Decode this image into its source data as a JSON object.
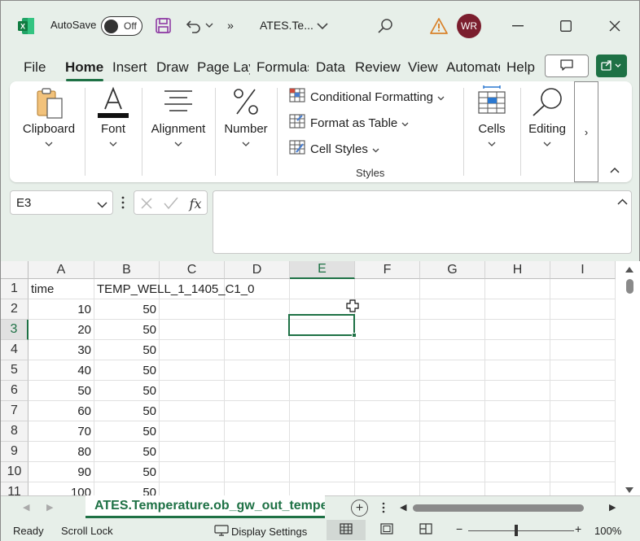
{
  "titlebar": {
    "autosave_label": "AutoSave",
    "toggle_text": "Off",
    "doc_title": "ATES.Te...",
    "avatar_initials": "WR",
    "more_glyph": "»"
  },
  "tabs": [
    "File",
    "Home",
    "Insert",
    "Draw",
    "Page Layout",
    "Formulas",
    "Data",
    "Review",
    "View",
    "Automate",
    "Help"
  ],
  "ribbon": {
    "clipboard": "Clipboard",
    "font": "Font",
    "alignment": "Alignment",
    "number": "Number",
    "conditional_formatting": "Conditional Formatting",
    "format_as_table": "Format as Table",
    "cell_styles": "Cell Styles",
    "styles_group": "Styles",
    "cells": "Cells",
    "editing": "Editing",
    "more_glyph": "›"
  },
  "formula_bar": {
    "name_box": "E3",
    "fx": "fx",
    "value": ""
  },
  "grid": {
    "columns": [
      "A",
      "B",
      "C",
      "D",
      "E",
      "F",
      "G",
      "H",
      "I"
    ],
    "selected_column": "E",
    "rows": [
      {
        "n": "1",
        "a": "time",
        "b": "TEMP_WELL_1_1405_C1_0"
      },
      {
        "n": "2",
        "a": "10",
        "b": "50"
      },
      {
        "n": "3",
        "a": "20",
        "b": "50"
      },
      {
        "n": "4",
        "a": "30",
        "b": "50"
      },
      {
        "n": "5",
        "a": "40",
        "b": "50"
      },
      {
        "n": "6",
        "a": "50",
        "b": "50"
      },
      {
        "n": "7",
        "a": "60",
        "b": "50"
      },
      {
        "n": "8",
        "a": "70",
        "b": "50"
      },
      {
        "n": "9",
        "a": "80",
        "b": "50"
      },
      {
        "n": "10",
        "a": "90",
        "b": "50"
      },
      {
        "n": "11",
        "a": "100",
        "b": "50"
      }
    ],
    "selected_row": "3"
  },
  "sheets": {
    "active_tab": "ATES.Temperature.ob_gw_out_temperature",
    "add_glyph": "+"
  },
  "status": {
    "ready": "Ready",
    "scroll_lock": "Scroll Lock",
    "display_settings": "Display Settings",
    "zoom": "100%",
    "zoom_fraction": 0.45
  },
  "colors": {
    "accent": "#1e7145",
    "avatar": "#7b1e2e",
    "window_bg": "#e7efe9"
  }
}
